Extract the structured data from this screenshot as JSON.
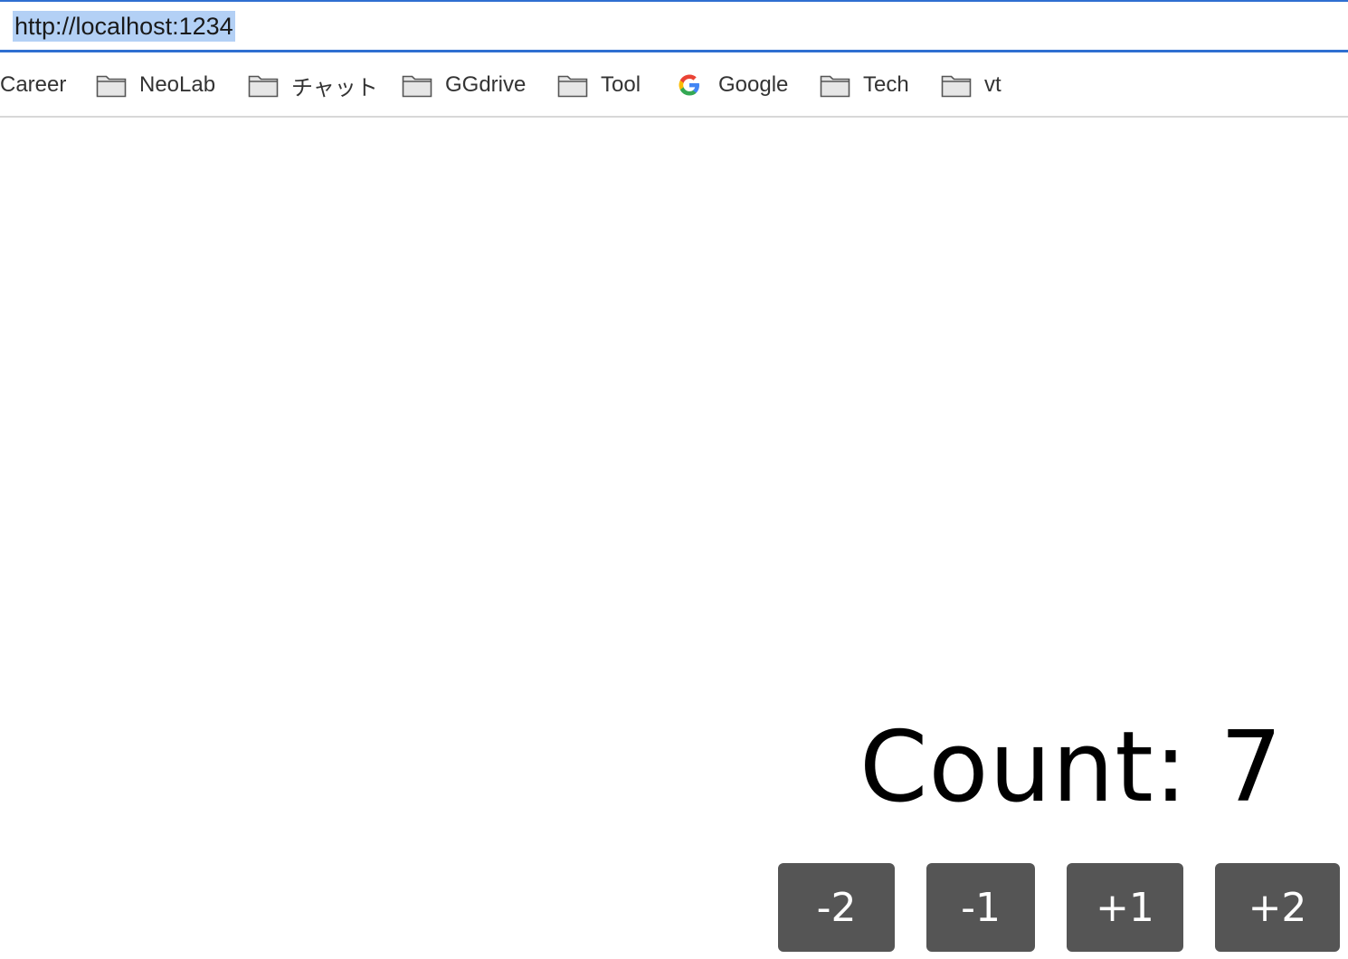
{
  "browser": {
    "url": "http://localhost:1234",
    "url_selected": true
  },
  "bookmarks": [
    {
      "label": "Career",
      "icon": "none"
    },
    {
      "label": "NeoLab",
      "icon": "folder-icon"
    },
    {
      "label": "チャット",
      "icon": "folder-icon"
    },
    {
      "label": "GGdrive",
      "icon": "folder-icon"
    },
    {
      "label": "Tool",
      "icon": "folder-icon"
    },
    {
      "label": "Google",
      "icon": "google-icon"
    },
    {
      "label": "Tech",
      "icon": "folder-icon"
    },
    {
      "label": "vt",
      "icon": "folder-icon"
    }
  ],
  "counter": {
    "prefix": "Count:",
    "value": 7,
    "display": "Count: 7"
  },
  "buttons": [
    {
      "label": "-2"
    },
    {
      "label": "-1"
    },
    {
      "label": "+1"
    },
    {
      "label": "+2"
    }
  ],
  "colors": {
    "address_bar_focus": "#2f6fd1",
    "url_selection": "#b3d0f5",
    "button_bg": "#555555",
    "button_text": "#ffffff"
  }
}
